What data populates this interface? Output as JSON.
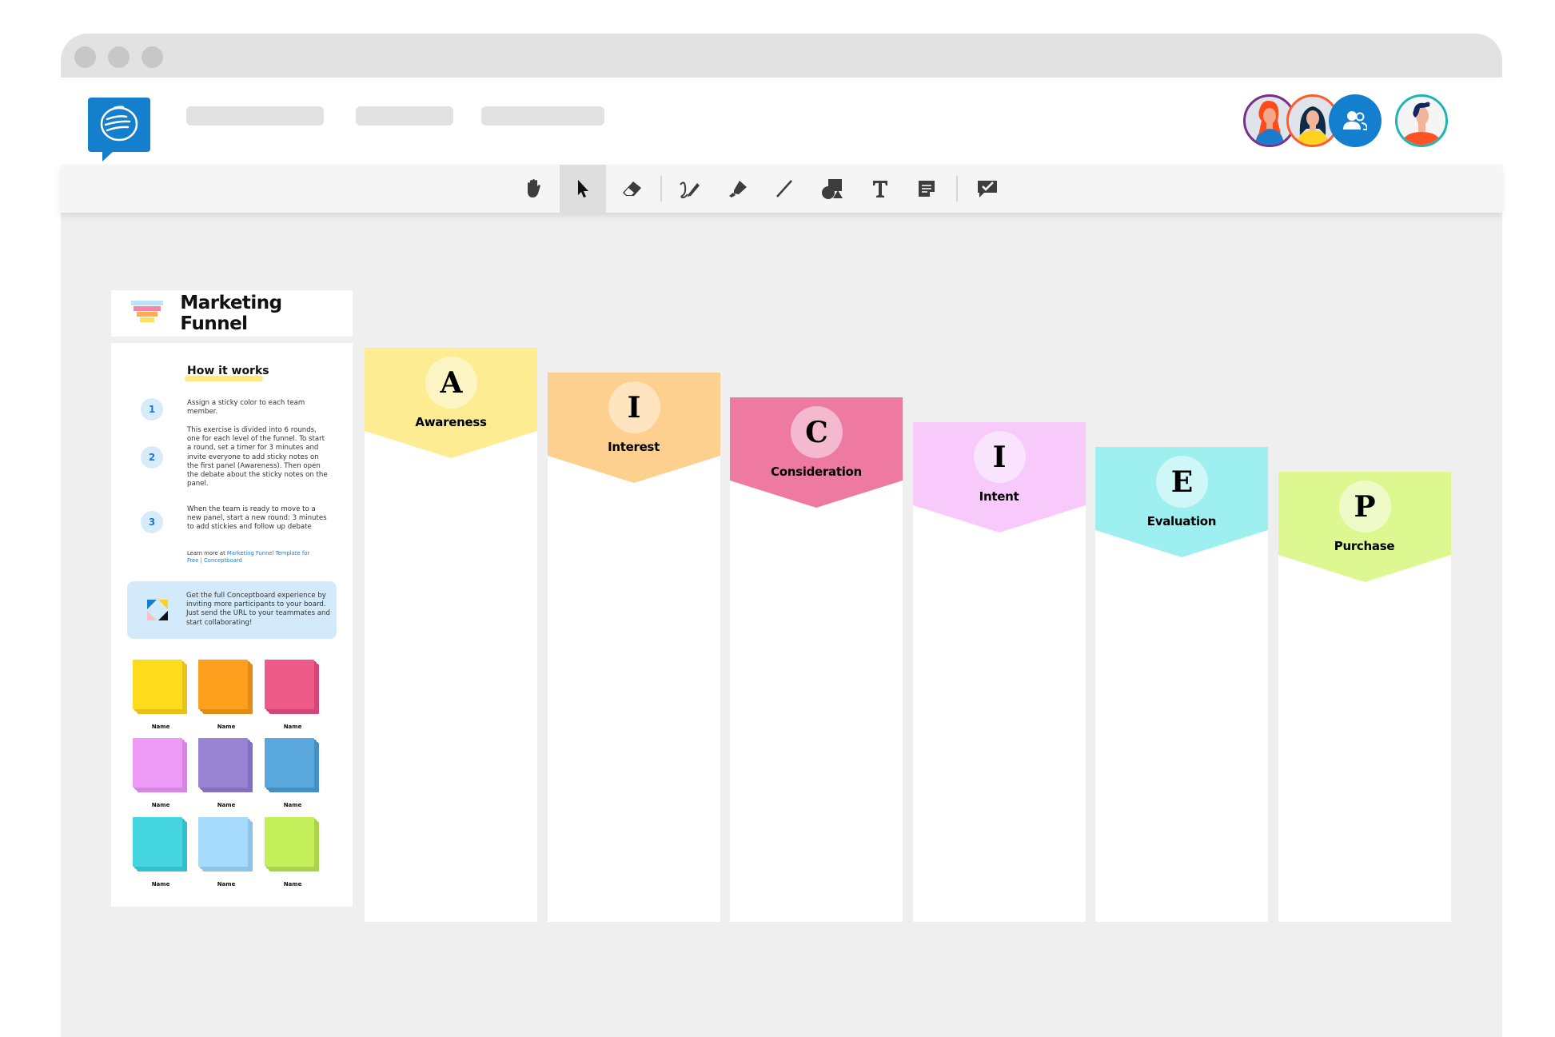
{
  "app": {
    "window_dots": 3,
    "logo": "conceptboard-logo",
    "nav_placeholders": 3
  },
  "users": [
    {
      "name": "user-red-hair",
      "ring": "#7b2d8e",
      "bg": "#dfe3ea",
      "hair": "#ff4a1c",
      "shirt": "#1a7ccd"
    },
    {
      "name": "user-dark-hair",
      "ring": "#ff5a2a",
      "bg": "#dfe3ea",
      "hair": "#0e2a44",
      "shirt": "#ffd21f"
    },
    {
      "name": "invite-users",
      "bg": "#147fcf",
      "icon": "users-icon"
    },
    {
      "name": "current-user",
      "ring": "#1fb5b5",
      "bg": "#f5f5f5",
      "hair": "#12275e",
      "shirt": "#ff5126"
    }
  ],
  "toolbar": {
    "tools": [
      {
        "id": "hand",
        "icon": "hand-icon",
        "active": false
      },
      {
        "id": "select",
        "icon": "cursor-icon",
        "active": true
      },
      {
        "id": "eraser",
        "icon": "eraser-icon",
        "active": false
      },
      {
        "id": "pen",
        "icon": "pen-icon",
        "active": false
      },
      {
        "id": "highlighter",
        "icon": "highlighter-icon",
        "active": false
      },
      {
        "id": "line",
        "icon": "line-icon",
        "active": false
      },
      {
        "id": "shapes",
        "icon": "shapes-icon",
        "active": false
      },
      {
        "id": "text",
        "icon": "text-icon",
        "active": false
      },
      {
        "id": "sticky-note",
        "icon": "sticky-note-icon",
        "active": false
      },
      {
        "id": "review",
        "icon": "comment-check-icon",
        "active": false
      }
    ]
  },
  "board": {
    "title": "Marketing Funnel",
    "how_it_works": "How it works",
    "steps": [
      {
        "num": "1",
        "text": "Assign a sticky color to each team member."
      },
      {
        "num": "2",
        "text": "This exercise is divided into 6 rounds, one for each level of the funnel. To start a round, set a timer for 3 minutes and invite everyone to add sticky notes on the first panel (Awareness). Then open the debate about the sticky notes on the panel."
      },
      {
        "num": "3",
        "text": "When the team is ready to move to a new panel, start a new round: 3 minutes to add stickies and follow up debate"
      }
    ],
    "learn_more_prefix": "Learn more at ",
    "learn_more_link": "Marketing Funnel Template for Free | Conceptboard",
    "promo_text": "Get the full Conceptboard experience by inviting more participants to your board. Just send the URL to your teammates and start collaborating!",
    "stickies": [
      {
        "label": "Name",
        "color": "#ffdb1e",
        "shade": "#e6c21a"
      },
      {
        "label": "Name",
        "color": "#ff9f1e",
        "shade": "#e58a14"
      },
      {
        "label": "Name",
        "color": "#ee5a8a",
        "shade": "#d2467a"
      },
      {
        "label": "Name",
        "color": "#ee9af7",
        "shade": "#d884e4"
      },
      {
        "label": "Name",
        "color": "#9984d4",
        "shade": "#8470c2"
      },
      {
        "label": "Name",
        "color": "#5aa7dc",
        "shade": "#468fc6"
      },
      {
        "label": "Name",
        "color": "#45d6e2",
        "shade": "#33bfcc"
      },
      {
        "label": "Name",
        "color": "#a6dbfc",
        "shade": "#8ec4e8"
      },
      {
        "label": "Name",
        "color": "#c4ef5a",
        "shade": "#aad44a"
      }
    ],
    "panels": [
      {
        "letter": "A",
        "label": "Awareness",
        "color": "#fdec91",
        "circle": "#fef5c4"
      },
      {
        "letter": "I",
        "label": "Interest",
        "color": "#fed08f",
        "circle": "#ffe4c0"
      },
      {
        "letter": "C",
        "label": "Consideration",
        "color": "#ee7aa2",
        "circle": "#f5b9cf"
      },
      {
        "letter": "I",
        "label": "Intent",
        "color": "#f7cafb",
        "circle": "#fae3fd"
      },
      {
        "letter": "E",
        "label": "Evaluation",
        "color": "#9ef0f0",
        "circle": "#cff7f7"
      },
      {
        "letter": "P",
        "label": "Purchase",
        "color": "#ddf891",
        "circle": "#eefbc8"
      }
    ]
  }
}
